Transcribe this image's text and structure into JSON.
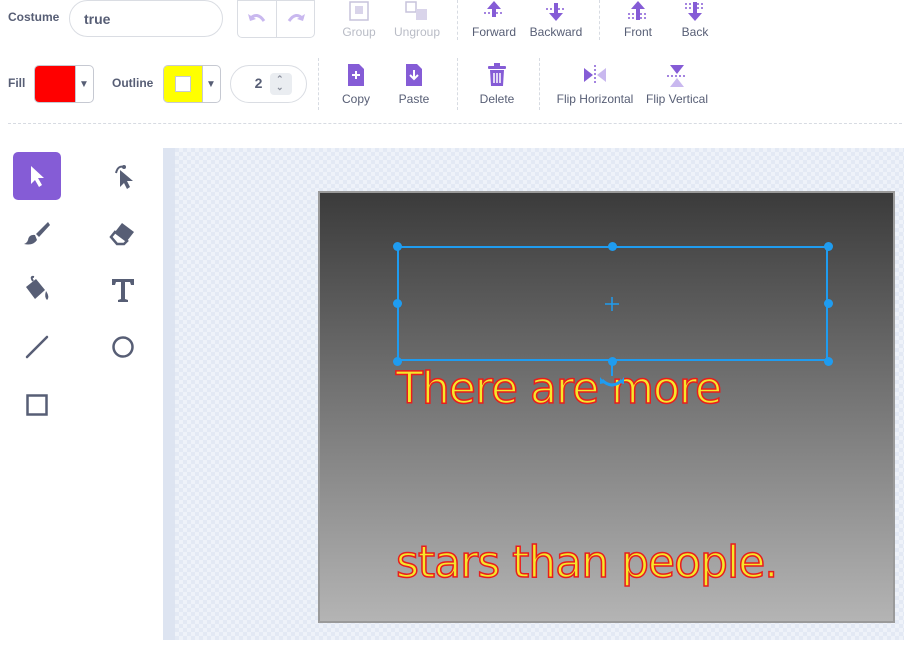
{
  "costume": {
    "label": "Costume",
    "name_value": "true"
  },
  "fill": {
    "label": "Fill",
    "color": "#ff0000"
  },
  "outline": {
    "label": "Outline",
    "color": "#ffff00",
    "width": "2"
  },
  "toolbar": {
    "group": "Group",
    "ungroup": "Ungroup",
    "forward": "Forward",
    "backward": "Backward",
    "front": "Front",
    "back": "Back",
    "copy": "Copy",
    "paste": "Paste",
    "delete": "Delete",
    "flip_horizontal": "Flip Horizontal",
    "flip_vertical": "Flip Vertical"
  },
  "canvas": {
    "text_line1": "There are more",
    "text_line2": "stars than people.",
    "text_fill": "#f6e72a",
    "text_outline": "#e81d1d"
  },
  "colors": {
    "accent": "#855cd6",
    "selection": "#1f9cf0"
  }
}
